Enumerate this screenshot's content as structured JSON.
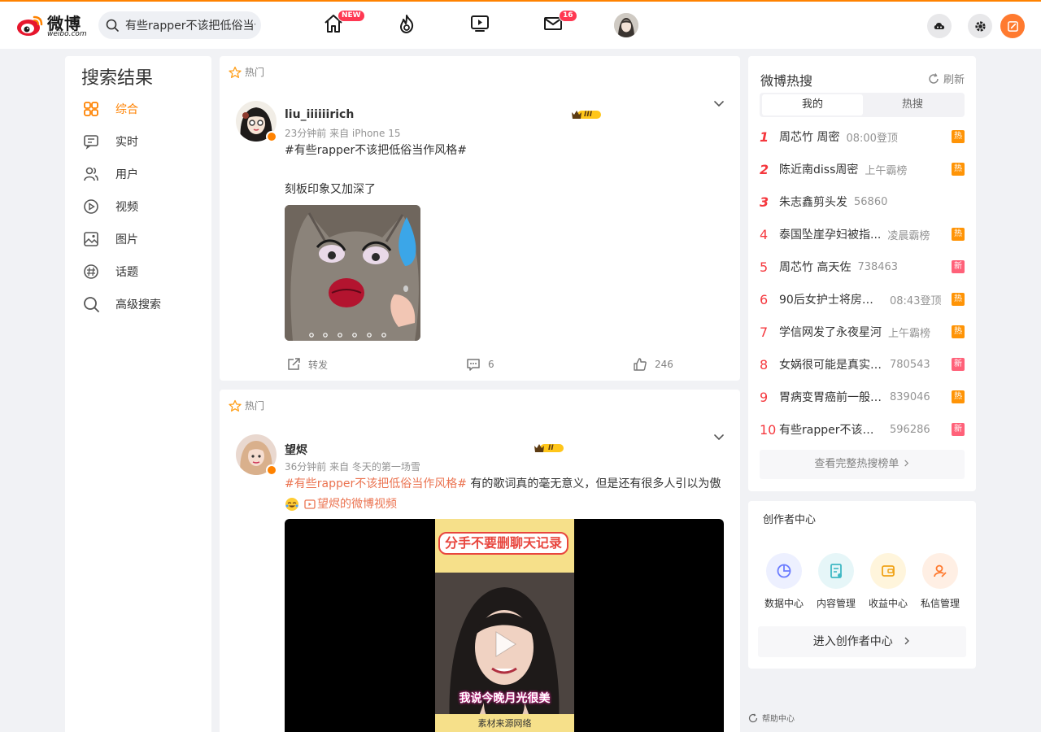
{
  "app": {
    "logo_text": "微博",
    "logo_domain": "weibo.com"
  },
  "search": {
    "value": "有些rapper不该把低俗当作风格"
  },
  "nav": {
    "home_badge": "NEW",
    "messages_badge": "16"
  },
  "leftnav": {
    "title": "搜索结果",
    "items": [
      {
        "label": "综合",
        "icon": "grid-icon"
      },
      {
        "label": "实时",
        "icon": "realtime-icon"
      },
      {
        "label": "用户",
        "icon": "users-icon"
      },
      {
        "label": "视频",
        "icon": "video-icon"
      },
      {
        "label": "图片",
        "icon": "image-icon"
      },
      {
        "label": "话题",
        "icon": "topic-icon"
      },
      {
        "label": "高级搜索",
        "icon": "search-icon"
      }
    ]
  },
  "posts": [
    {
      "tag": "热门",
      "username": "liu_iiiiiirich",
      "vip_level": "III",
      "meta": "23分钟前  来自 iPhone 15",
      "hashtag": "#有些rapper不该把低俗当作风格#",
      "text": "刻板印象又加深了",
      "repost_label": "转发",
      "comments": "6",
      "likes": "246"
    },
    {
      "tag": "热门",
      "username": "望烬",
      "vip_level": "II",
      "meta": "36分钟前  来自 冬天的第一场雪",
      "hashtag": "#有些rapper不该把低俗当作风格#",
      "text": " 有的歌词真的毫无意义，但是还有很多人引以为傲",
      "video_link": "望烬的微博视频",
      "video_title": "分手不要删聊天记录",
      "video_caption": "我说今晚月光很美",
      "video_source": "素材来源网络"
    }
  ],
  "hot_search": {
    "title": "微博热搜",
    "refresh": "刷新",
    "tabs": [
      "我的",
      "热搜"
    ],
    "items": [
      {
        "rank": "1",
        "word": "周芯竹 周密",
        "num": "08:00登顶",
        "flag": "热"
      },
      {
        "rank": "2",
        "word": "陈近南diss周密",
        "num": "上午霸榜",
        "flag": "热"
      },
      {
        "rank": "3",
        "word": "朱志鑫剪头发",
        "num": "56860",
        "flag": ""
      },
      {
        "rank": "4",
        "word": "泰国坠崖孕妇被指...",
        "num": "凌晨霸榜",
        "flag": "热"
      },
      {
        "rank": "5",
        "word": "周芯竹 高天佐",
        "num": "738463",
        "flag": "新"
      },
      {
        "rank": "6",
        "word": "90后女护士将房间...",
        "num": "08:43登顶",
        "flag": "热"
      },
      {
        "rank": "7",
        "word": "学信网发了永夜星河",
        "num": "上午霸榜",
        "flag": "热"
      },
      {
        "rank": "8",
        "word": "女娲很可能是真实存...",
        "num": "780543",
        "flag": "新"
      },
      {
        "rank": "9",
        "word": "胃病变胃癌前一般有...",
        "num": "839046",
        "flag": "热"
      },
      {
        "rank": "10",
        "word": "有些rapper不该把低...",
        "num": "596286",
        "flag": "新"
      }
    ],
    "see_all": "查看完整热搜榜单"
  },
  "creator": {
    "title": "创作者中心",
    "items": [
      {
        "label": "数据中心",
        "icon": "data-icon",
        "color": "#6b7cff"
      },
      {
        "label": "内容管理",
        "icon": "content-icon",
        "color": "#3fb8c4"
      },
      {
        "label": "收益中心",
        "icon": "wallet-icon",
        "color": "#f0a318"
      },
      {
        "label": "私信管理",
        "icon": "message-manage-icon",
        "color": "#ff7a2f"
      }
    ],
    "enter": "进入创作者中心"
  },
  "footer": {
    "help": "帮助中心"
  },
  "colors": {
    "accent": "#ff8200",
    "hashtag": "#eb7350",
    "hot_flag": "#ff9406",
    "new_flag": "#ff6179"
  }
}
